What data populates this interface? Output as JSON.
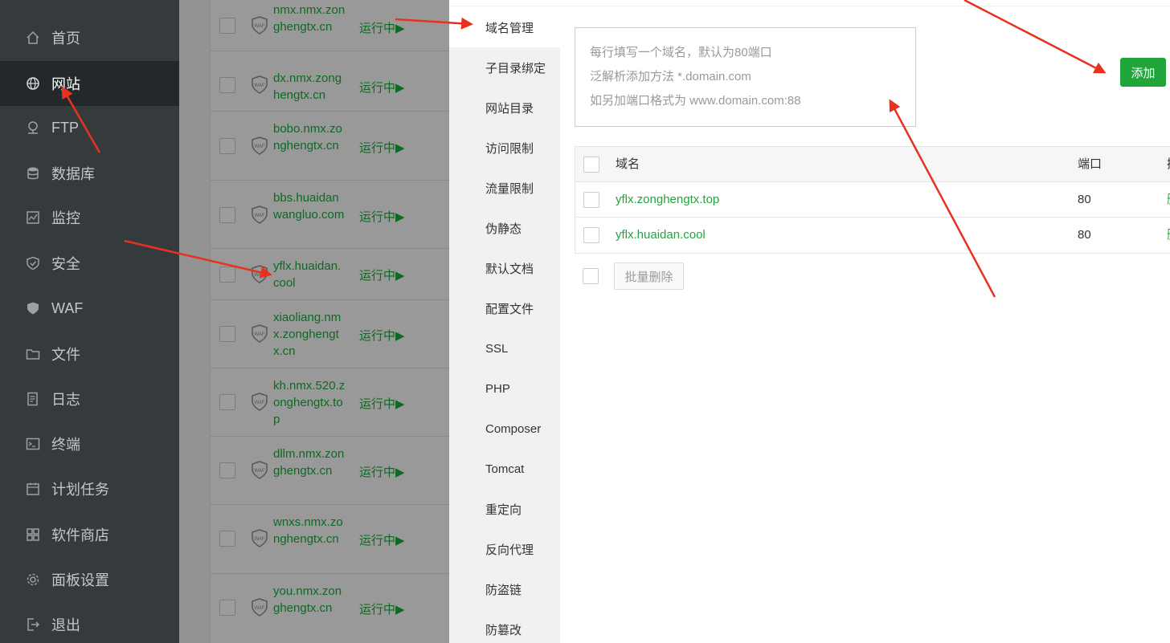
{
  "sidebar": {
    "items": [
      {
        "label": "首页",
        "icon": "home-icon"
      },
      {
        "label": "网站",
        "icon": "globe-icon",
        "active": true
      },
      {
        "label": "FTP",
        "icon": "ftp-icon"
      },
      {
        "label": "数据库",
        "icon": "database-icon"
      },
      {
        "label": "监控",
        "icon": "monitor-icon"
      },
      {
        "label": "安全",
        "icon": "shield-icon"
      },
      {
        "label": "WAF",
        "icon": "waf-shield-icon"
      },
      {
        "label": "文件",
        "icon": "folder-icon"
      },
      {
        "label": "日志",
        "icon": "log-icon"
      },
      {
        "label": "终端",
        "icon": "terminal-icon"
      },
      {
        "label": "计划任务",
        "icon": "calendar-icon"
      },
      {
        "label": "软件商店",
        "icon": "apps-icon"
      },
      {
        "label": "面板设置",
        "icon": "gear-icon"
      },
      {
        "label": "退出",
        "icon": "logout-icon"
      }
    ]
  },
  "sites": [
    {
      "name": "nmx.nmx.zonghengtx.cn",
      "status": "运行中▶"
    },
    {
      "name": "dx.nmx.zonghengtx.cn",
      "status": "运行中▶"
    },
    {
      "name": "bobo.nmx.zonghengtx.cn",
      "status": "运行中▶"
    },
    {
      "name": "bbs.huaidanwangluo.com",
      "status": "运行中▶"
    },
    {
      "name": "yflx.huaidan.cool",
      "status": "运行中▶"
    },
    {
      "name": "xiaoliang.nmx.zonghengtx.cn",
      "status": "运行中▶"
    },
    {
      "name": "kh.nmx.520.zonghengtx.top",
      "status": "运行中▶"
    },
    {
      "name": "dllm.nmx.zonghengtx.cn",
      "status": "运行中▶"
    },
    {
      "name": "wnxs.nmx.zonghengtx.cn",
      "status": "运行中▶"
    },
    {
      "name": "you.nmx.zonghengtx.cn",
      "status": "运行中▶"
    }
  ],
  "modal": {
    "tabs": [
      "域名管理",
      "子目录绑定",
      "网站目录",
      "访问限制",
      "流量限制",
      "伪静态",
      "默认文档",
      "配置文件",
      "SSL",
      "PHP",
      "Composer",
      "Tomcat",
      "重定向",
      "反向代理",
      "防盗链",
      "防篡改"
    ],
    "active_tab": "域名管理",
    "textarea_placeholder": [
      "每行填写一个域名，默认为80端口",
      "泛解析添加方法 *.domain.com",
      "如另加端口格式为 www.domain.com:88"
    ],
    "add_label": "添加",
    "table": {
      "headers": {
        "name": "域名",
        "port": "端口",
        "op": "操"
      },
      "rows": [
        {
          "domain": "yflx.zonghengtx.top",
          "port": "80",
          "op": "删"
        },
        {
          "domain": "yflx.huaidan.cool",
          "port": "80",
          "op": "删"
        }
      ]
    },
    "batch_delete_label": "批量删除"
  },
  "colors": {
    "accent": "#20a53a",
    "sidebar_bg": "#353b3d",
    "arrow": "#e8321f"
  }
}
